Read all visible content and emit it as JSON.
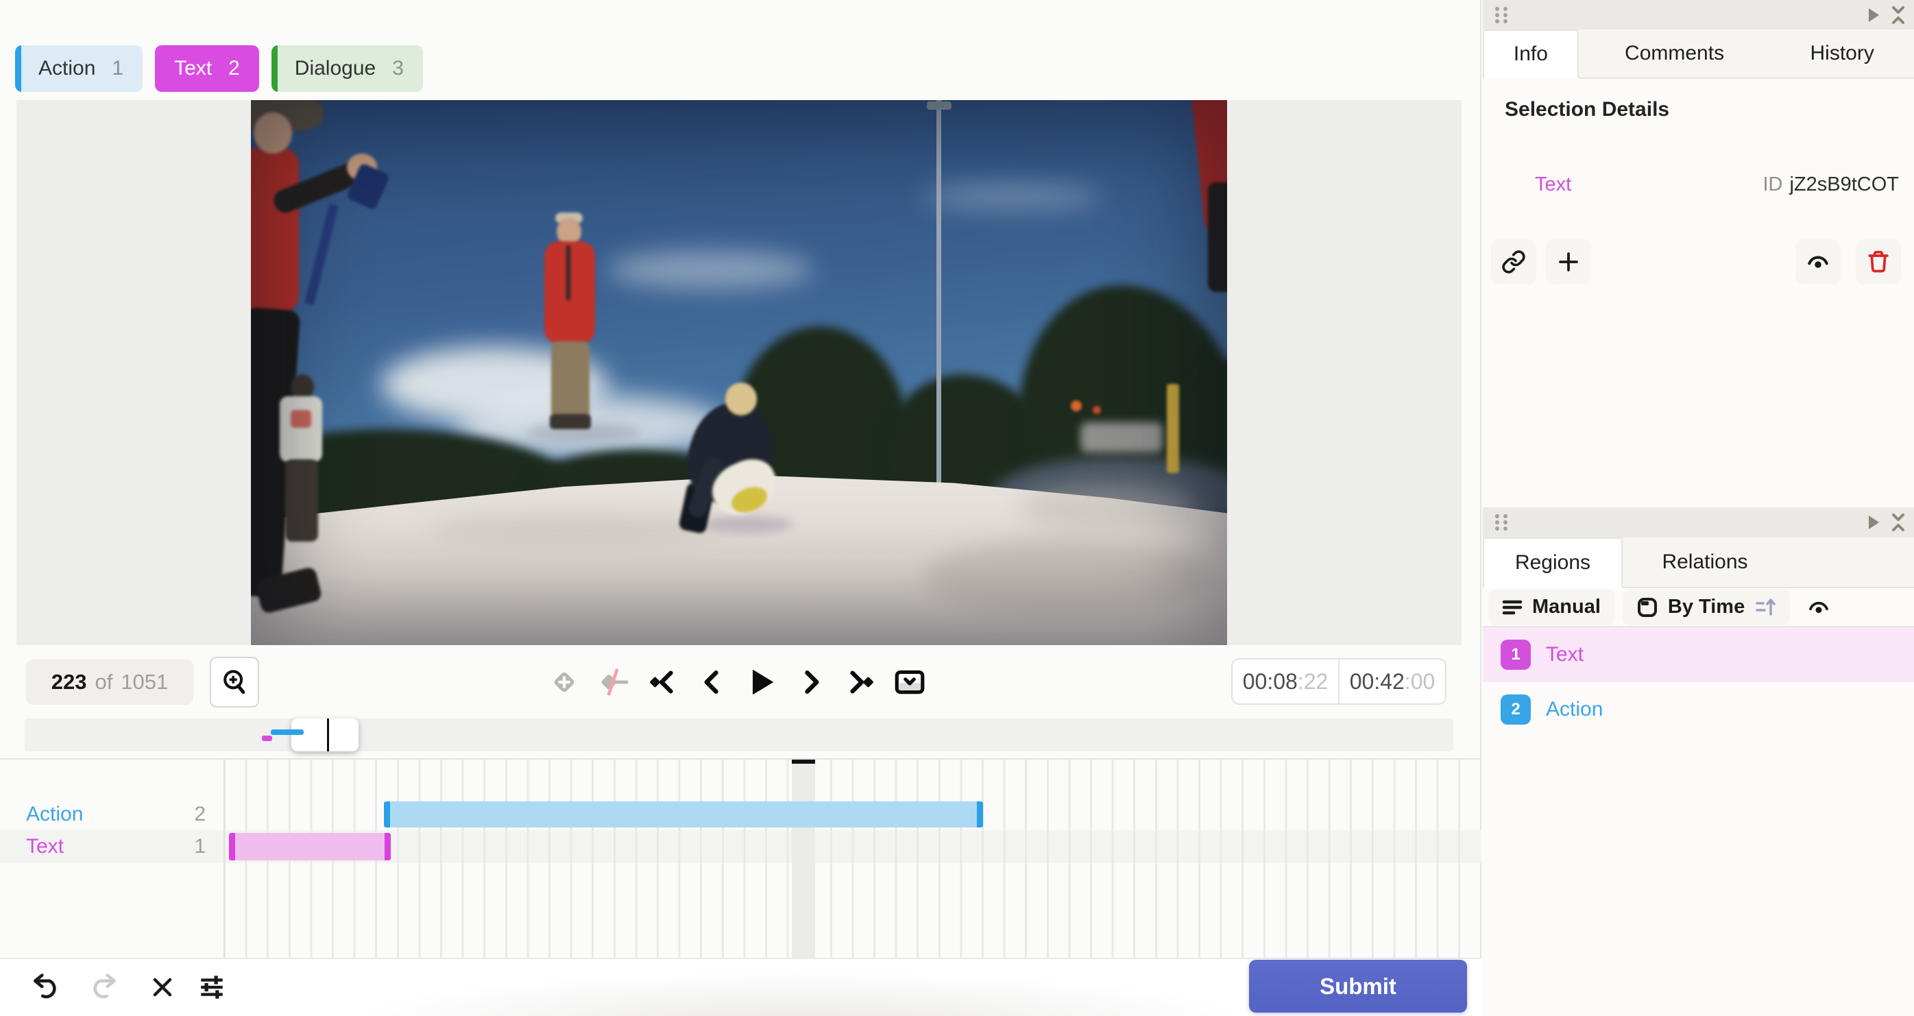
{
  "tags": [
    {
      "label": "Action",
      "hotkey": "1"
    },
    {
      "label": "Text",
      "hotkey": "2"
    },
    {
      "label": "Dialogue",
      "hotkey": "3"
    }
  ],
  "frame_counter": {
    "current": "223",
    "of": "of",
    "total": "1051"
  },
  "timecodes": {
    "current_main": "00:08",
    "current_frames": ":22",
    "total_main": "00:42",
    "total_frames": ":00"
  },
  "timeline": {
    "tracks": [
      {
        "label": "Action",
        "count": "2"
      },
      {
        "label": "Text",
        "count": "1"
      }
    ]
  },
  "footer": {
    "submit_label": "Submit"
  },
  "panel_info": {
    "tabs": [
      "Info",
      "Comments",
      "History"
    ],
    "heading": "Selection Details",
    "selection_label": "Text",
    "id_label": "ID",
    "id_value": "jZ2sB9tCOT"
  },
  "panel_regions": {
    "tabs": [
      "Regions",
      "Relations"
    ],
    "group_button": "Manual",
    "order_button": "By Time",
    "regions": [
      {
        "num": "1",
        "label": "Text"
      },
      {
        "num": "2",
        "label": "Action"
      }
    ]
  },
  "colors": {
    "action_blue": "#2aa1e8",
    "text_magenta": "#d94ce1",
    "dialogue_green": "#31a133",
    "submit_indigo": "#5b69c7",
    "danger_red": "#dc2626"
  }
}
